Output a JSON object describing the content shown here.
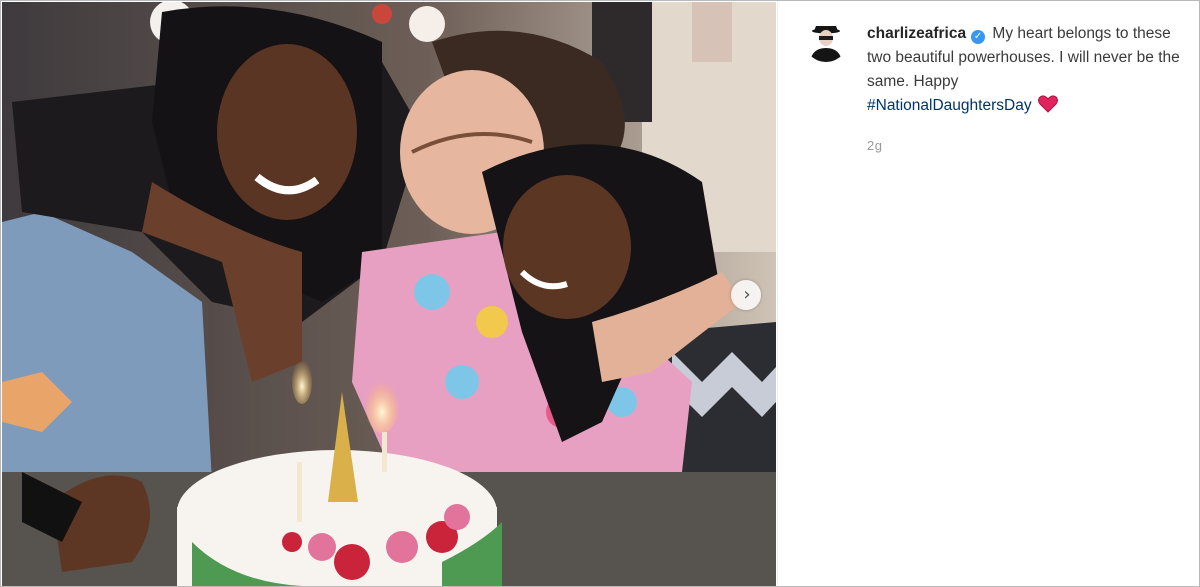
{
  "post": {
    "username": "charlizeafrica",
    "caption_text": "My heart belongs to these two beautiful powerhouses. I will never be the same. Happy",
    "hashtag": "#NationalDaughtersDay",
    "time_ago": "2g",
    "verified_icon": "verified-check-icon",
    "heart_icon": "red-heart-emoji-icon",
    "next_icon": "chevron-right-icon"
  },
  "colors": {
    "username": "#262626",
    "caption": "#3a3a3a",
    "hashtag": "#003569",
    "verified_badge": "#3897f0",
    "heart": "#e0245e",
    "timestamp": "#999999"
  }
}
